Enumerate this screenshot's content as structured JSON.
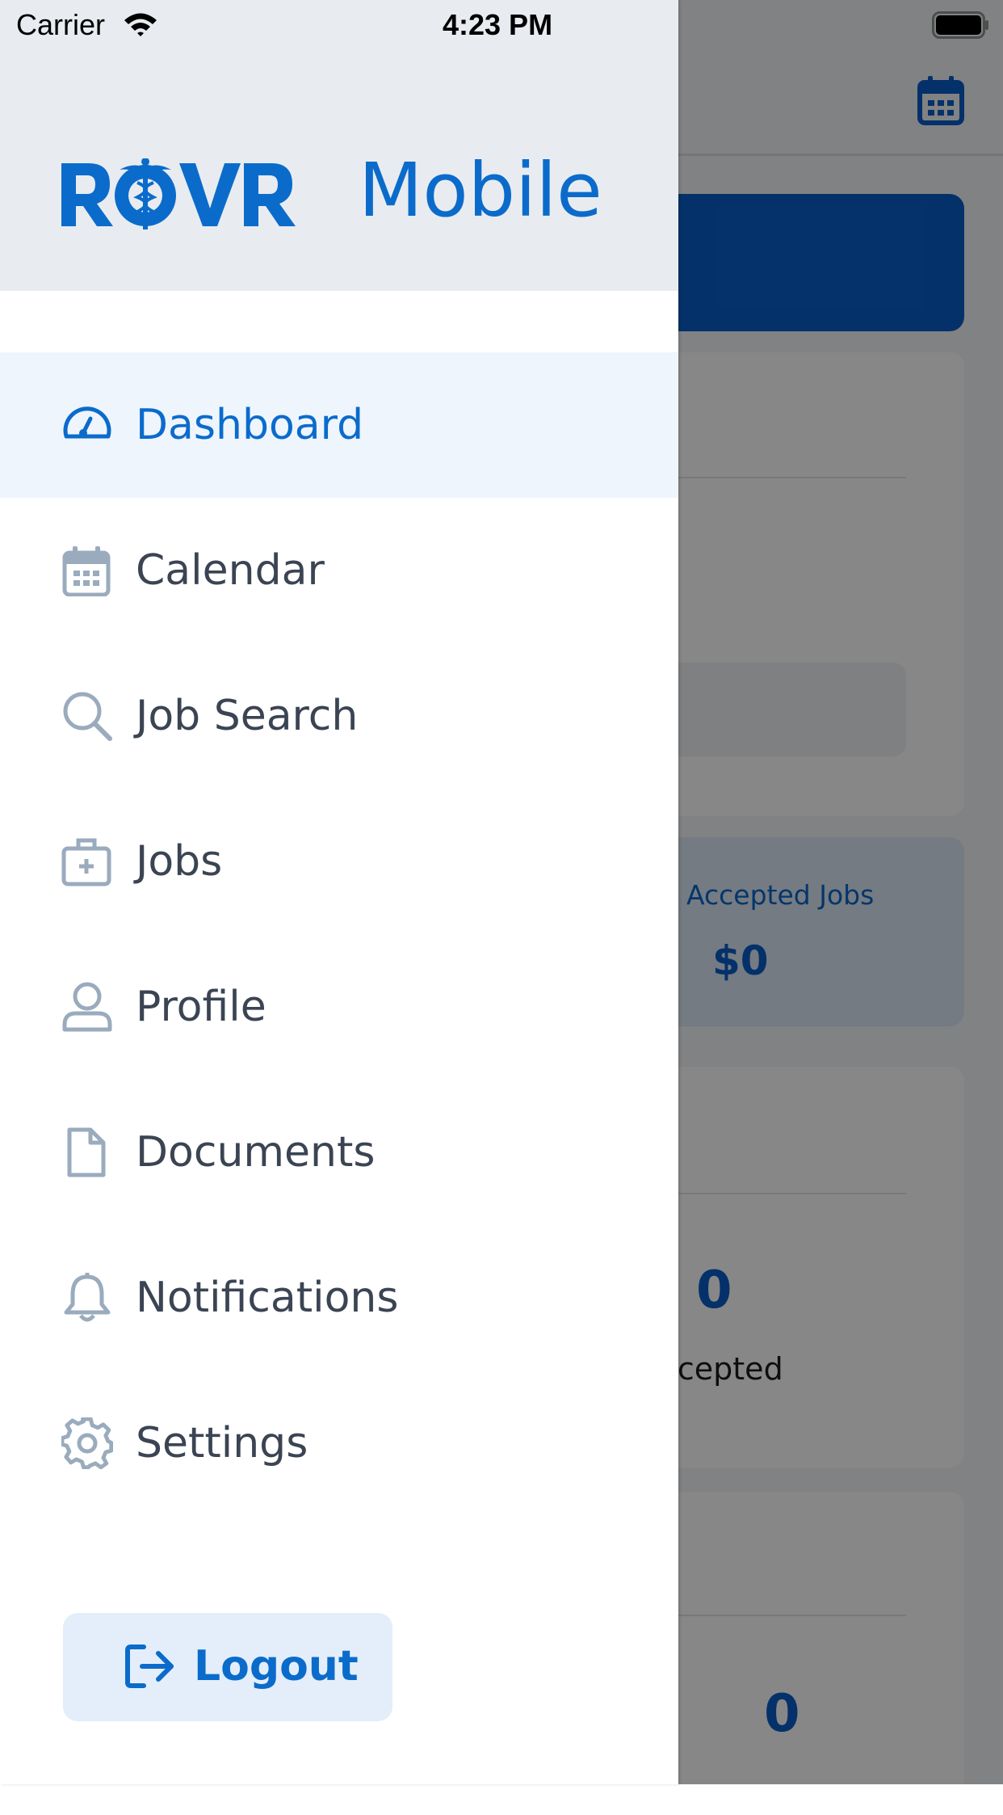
{
  "status_bar": {
    "carrier": "Carrier",
    "time": "4:23 PM",
    "wifi_icon": "wifi-icon",
    "battery_icon": "battery-icon"
  },
  "drawer": {
    "logo_text": "ROVR",
    "logo_subtitle": "Mobile",
    "menu": [
      {
        "label": "Dashboard",
        "icon": "speedometer-icon",
        "active": true
      },
      {
        "label": "Calendar",
        "icon": "calendar-icon",
        "active": false
      },
      {
        "label": "Job Search",
        "icon": "search-icon",
        "active": false
      },
      {
        "label": "Jobs",
        "icon": "medical-bag-icon",
        "active": false
      },
      {
        "label": "Profile",
        "icon": "user-icon",
        "active": false
      },
      {
        "label": "Documents",
        "icon": "document-icon",
        "active": false
      },
      {
        "label": "Notifications",
        "icon": "bell-icon",
        "active": false
      },
      {
        "label": "Settings",
        "icon": "gear-icon",
        "active": false
      }
    ],
    "logout_label": "Logout",
    "logout_icon": "logout-icon"
  },
  "background_screen": {
    "accepted_jobs_label": "Accepted Jobs",
    "accepted_jobs_value": "$0",
    "stat_1_value": "0",
    "stat_1_label": "ccepted",
    "stat_2_value": "0"
  },
  "colors": {
    "brand_blue": "#0b6bcb",
    "header_bg": "#e8ecf0",
    "active_item_bg": "#eef5fc",
    "icon_gray": "#9aabbd",
    "text_dark": "#3b4453",
    "logout_bg": "#e3eefa"
  }
}
